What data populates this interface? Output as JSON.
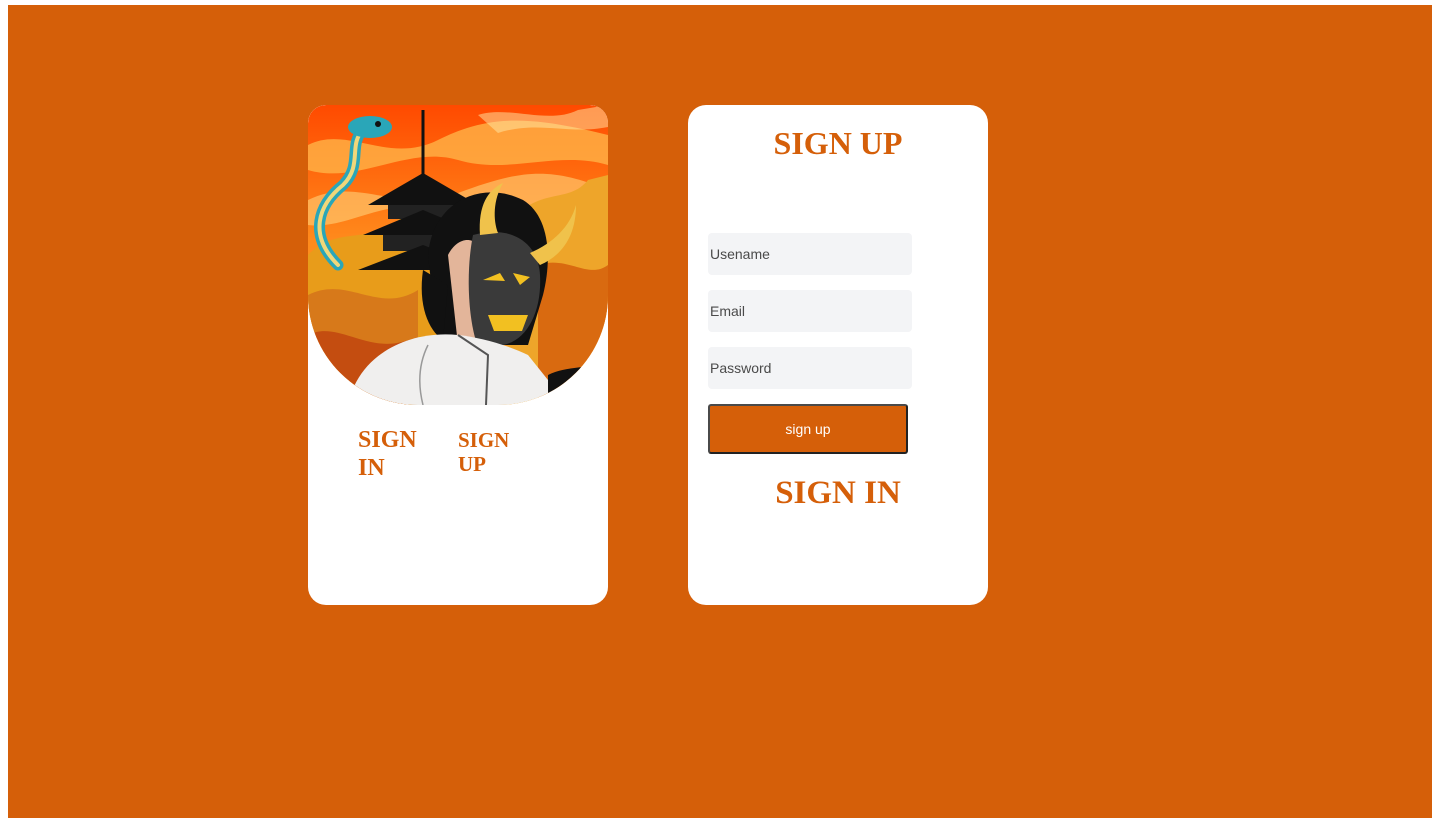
{
  "colors": {
    "background": "#d55f09",
    "card": "#ffffff",
    "accent": "#d55f09",
    "input_bg": "#f3f4f6"
  },
  "left_card": {
    "illustration": "oni-mask-anime-character-with-dragon-and-pagoda",
    "tabs": [
      {
        "label": "SIGN IN"
      },
      {
        "label": "SIGN UP"
      }
    ]
  },
  "form": {
    "title": "SIGN UP",
    "fields": [
      {
        "placeholder": "Usename",
        "value": ""
      },
      {
        "placeholder": "Email",
        "value": ""
      },
      {
        "placeholder": "Password",
        "value": ""
      }
    ],
    "submit_label": "sign up",
    "switch_label": "SIGN IN"
  }
}
